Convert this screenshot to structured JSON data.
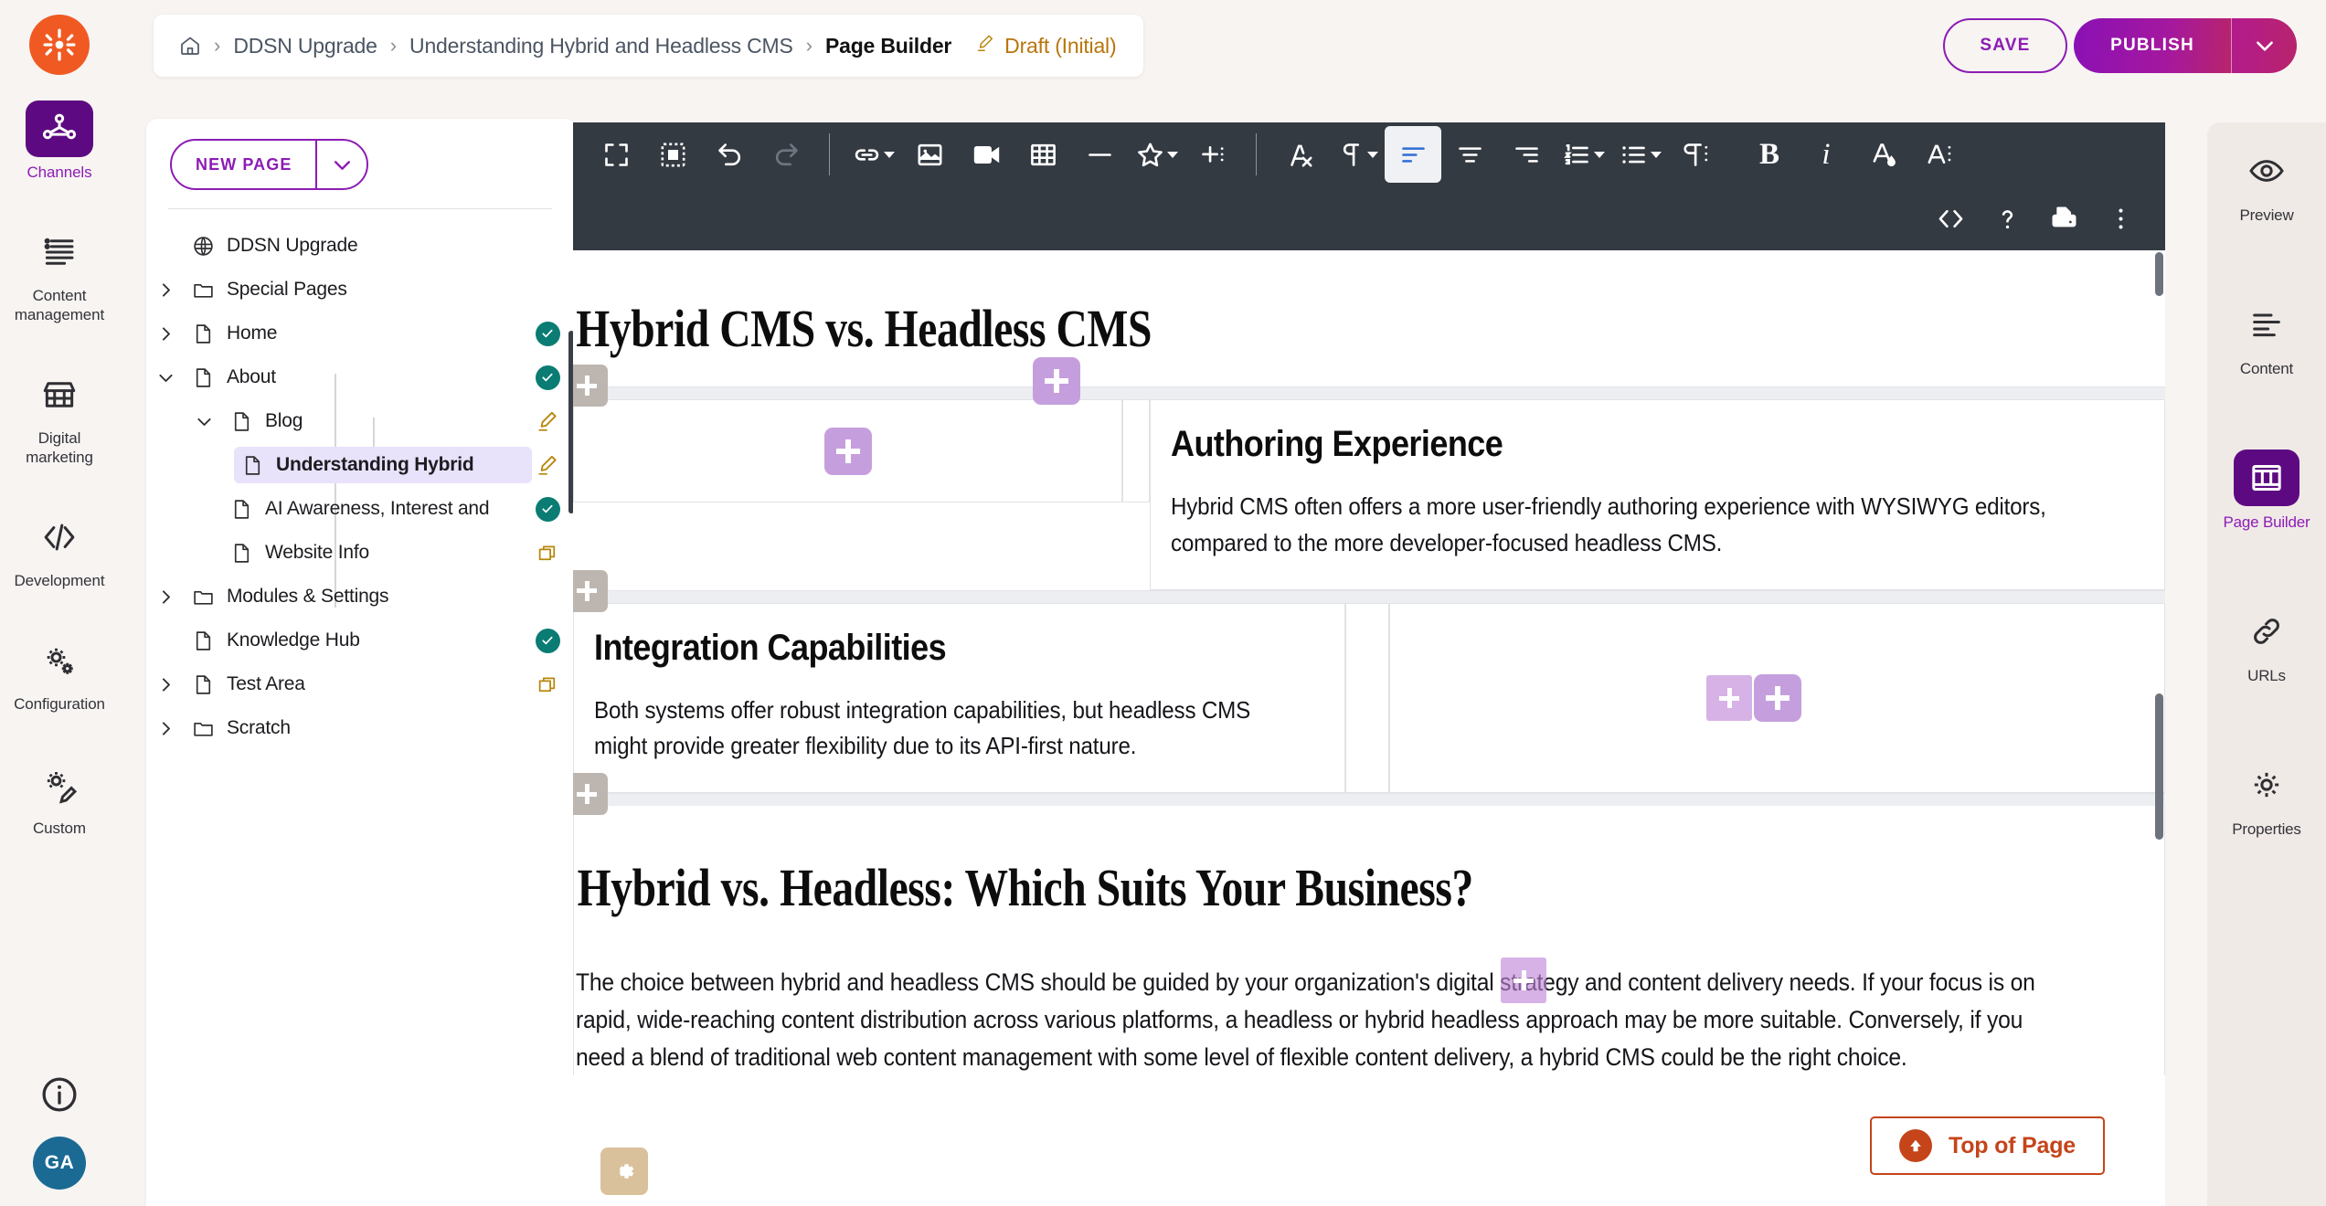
{
  "app": {
    "logo_icon": "kentico-asterisk-logo"
  },
  "breadcrumb": {
    "home_icon": "home-icon",
    "separator": "›",
    "items": [
      "DDSN Upgrade",
      "Understanding Hybrid and Headless CMS",
      "Page Builder"
    ],
    "status_icon": "pencil-draft-icon",
    "status_label": "Draft (Initial)"
  },
  "header_actions": {
    "save_label": "SAVE",
    "publish_label": "PUBLISH",
    "publish_caret_icon": "chevron-down-icon"
  },
  "left_rail": {
    "items": [
      {
        "label": "Channels",
        "icon": "channels-network-icon",
        "active": true
      },
      {
        "label": "Content management",
        "icon": "content-list-icon",
        "active": false
      },
      {
        "label": "Digital marketing",
        "icon": "storefront-icon",
        "active": false
      },
      {
        "label": "Development",
        "icon": "code-brackets-icon",
        "active": false
      },
      {
        "label": "Configuration",
        "icon": "gears-icon",
        "active": false
      },
      {
        "label": "Custom",
        "icon": "gear-pencil-icon",
        "active": false
      }
    ],
    "info_icon": "info-circle-icon",
    "avatar_initials": "GA"
  },
  "tree_panel": {
    "new_page_label": "NEW PAGE",
    "new_page_caret_icon": "chevron-down-icon",
    "root": {
      "label": "DDSN Upgrade",
      "icon": "globe-channel-icon"
    },
    "nodes": [
      {
        "label": "Special Pages",
        "icon": "folder-icon",
        "caret": "right",
        "indent": 0,
        "status": ""
      },
      {
        "label": "Home",
        "icon": "page-icon",
        "caret": "right",
        "indent": 0,
        "status": "published"
      },
      {
        "label": "About",
        "icon": "page-icon",
        "caret": "down",
        "indent": 0,
        "status": "published"
      },
      {
        "label": "Blog",
        "icon": "page-icon",
        "caret": "down",
        "indent": 1,
        "status": "draft"
      },
      {
        "label": "Understanding Hybrid",
        "icon": "page-icon",
        "caret": "none",
        "indent": 2,
        "status": "draft",
        "selected": true
      },
      {
        "label": "AI Awareness, Interest and",
        "icon": "page-icon",
        "caret": "none",
        "indent": 1,
        "status": "published"
      },
      {
        "label": "Website Info",
        "icon": "page-icon",
        "caret": "none",
        "indent": 1,
        "status": "copy"
      },
      {
        "label": "Modules & Settings",
        "icon": "folder-icon",
        "caret": "right",
        "indent": 0,
        "status": ""
      },
      {
        "label": "Knowledge Hub",
        "icon": "page-icon",
        "caret": "none",
        "indent": 0,
        "status": "published"
      },
      {
        "label": "Test Area",
        "icon": "page-icon",
        "caret": "right",
        "indent": 0,
        "status": "copy"
      },
      {
        "label": "Scratch",
        "icon": "folder-icon",
        "caret": "right",
        "indent": 0,
        "status": ""
      }
    ]
  },
  "toolbar": {
    "row1": [
      {
        "name": "fullscreen-icon",
        "type": "icon"
      },
      {
        "name": "select-all-icon",
        "type": "icon"
      },
      {
        "name": "undo-icon",
        "type": "icon"
      },
      {
        "name": "redo-icon",
        "type": "icon",
        "disabled": true
      },
      {
        "name": "separator",
        "type": "sep"
      },
      {
        "name": "insert-link-icon",
        "type": "icon",
        "caret": true
      },
      {
        "name": "insert-image-icon",
        "type": "icon"
      },
      {
        "name": "insert-video-icon",
        "type": "icon"
      },
      {
        "name": "insert-table-icon",
        "type": "icon"
      },
      {
        "name": "horizontal-rule-icon",
        "type": "icon"
      },
      {
        "name": "special-character-icon",
        "type": "icon",
        "caret": true
      },
      {
        "name": "insert-more-icon",
        "type": "icon"
      },
      {
        "name": "separator",
        "type": "sep"
      },
      {
        "name": "clear-formatting-icon",
        "type": "icon"
      },
      {
        "name": "paragraph-format-icon",
        "type": "icon",
        "caret": true
      },
      {
        "name": "align-left-icon",
        "type": "icon",
        "active": true
      },
      {
        "name": "align-center-icon",
        "type": "icon"
      },
      {
        "name": "align-right-icon",
        "type": "icon"
      },
      {
        "name": "ordered-list-icon",
        "type": "icon",
        "caret": true
      },
      {
        "name": "unordered-list-icon",
        "type": "icon",
        "caret": true
      },
      {
        "name": "paragraph-style-icon",
        "type": "icon"
      },
      {
        "name": "bold-icon",
        "type": "text",
        "glyph": "B"
      },
      {
        "name": "italic-icon",
        "type": "text",
        "glyph": "i"
      },
      {
        "name": "text-color-icon",
        "type": "icon"
      },
      {
        "name": "font-size-icon",
        "type": "icon"
      }
    ],
    "row2": [
      {
        "name": "code-view-icon"
      },
      {
        "name": "help-icon"
      },
      {
        "name": "print-icon"
      },
      {
        "name": "more-options-icon"
      }
    ]
  },
  "document": {
    "h1": "Hybrid CMS vs. Headless CMS",
    "cards": [
      {
        "heading": "Authoring Experience",
        "body": "Hybrid CMS often offers a more user-friendly authoring experience with WYSIWYG editors, compared to the more developer-focused headless CMS."
      },
      {
        "heading": "Integration Capabilities",
        "body": "Both systems offer robust integration capabilities, but headless CMS might provide greater flexibility due to its API-first nature."
      }
    ],
    "h1_second": "Hybrid vs. Headless: Which Suits Your Business?",
    "paragraph": "The choice between hybrid and headless CMS should be guided by your organization's digital strategy and content delivery needs. If your focus is on rapid, wide-reaching content distribution across various platforms, a headless or hybrid headless approach may be more suitable. Conversely, if you need a blend of traditional web content management with some level of flexible content delivery, a hybrid CMS could be the right choice.",
    "add_widget_icon": "plus-icon",
    "section_settings_icon": "gear-icon",
    "top_of_page_label": "Top of Page",
    "top_of_page_icon": "arrow-up-circle-icon"
  },
  "right_rail": {
    "items": [
      {
        "label": "Preview",
        "icon": "eye-icon",
        "active": false
      },
      {
        "label": "Content",
        "icon": "content-lines-icon",
        "active": false
      },
      {
        "label": "Page Builder",
        "icon": "page-builder-columns-icon",
        "active": true
      },
      {
        "label": "URLs",
        "icon": "link-chain-icon",
        "active": false
      },
      {
        "label": "Properties",
        "icon": "gear-icon",
        "active": false
      }
    ]
  },
  "colors": {
    "brand_orange": "#f05a22",
    "brand_purple": "#8c1cb4",
    "dark_purple": "#5d0a82",
    "toolbar_dark": "#343a42",
    "widget_purple": "#c59fdd",
    "published_teal": "#0a7c73",
    "draft_gold": "#b8860b",
    "accent_red": "#c5441a",
    "avatar_blue": "#1b6a94"
  }
}
